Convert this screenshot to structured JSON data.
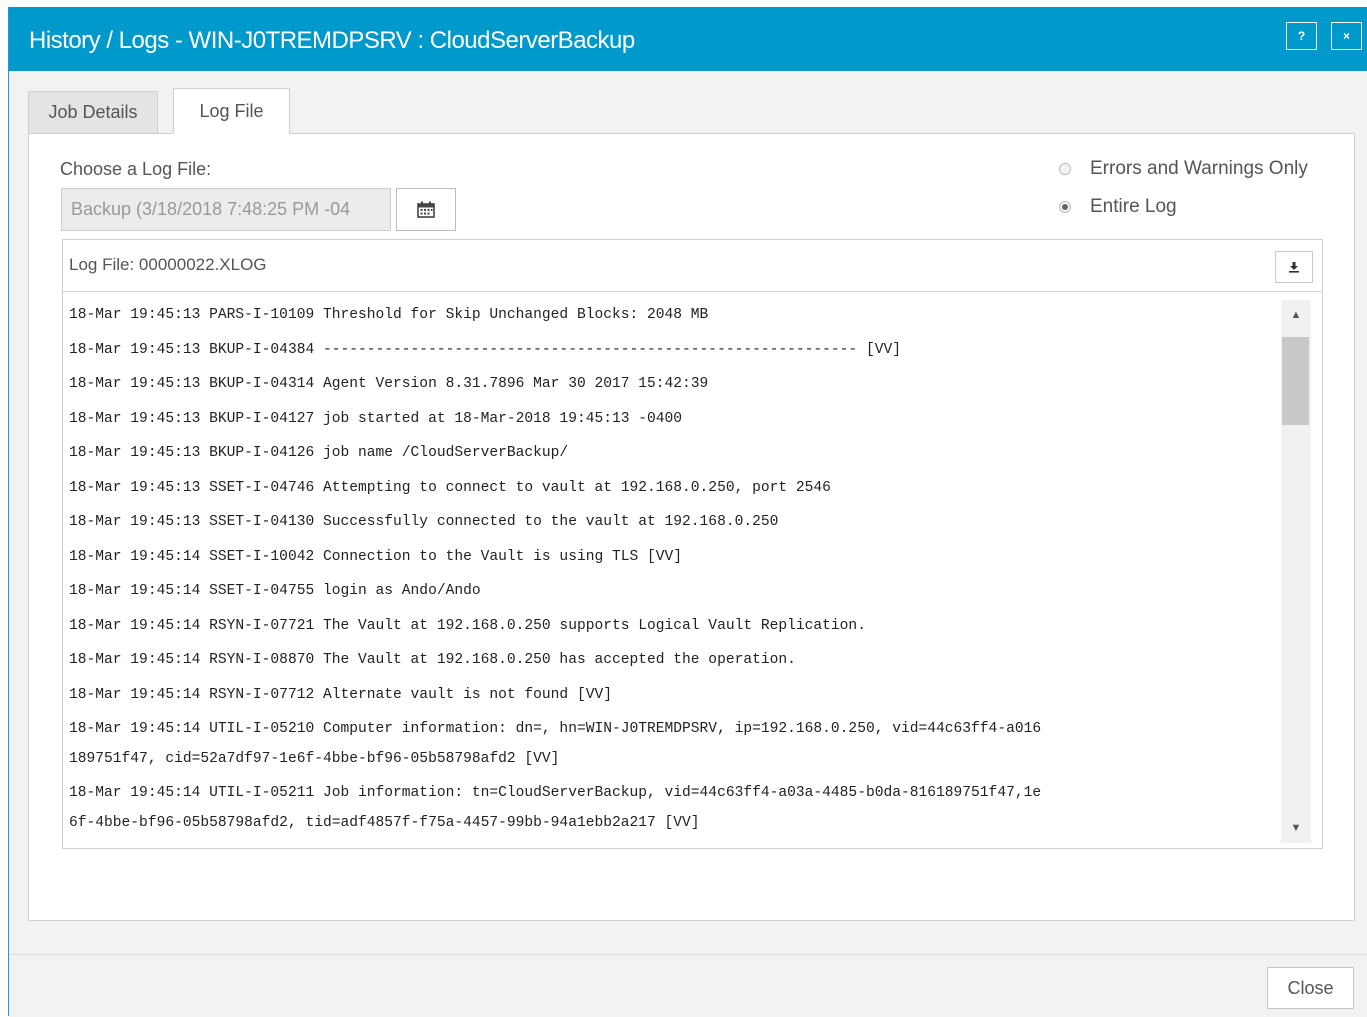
{
  "window": {
    "title": "History / Logs - WIN-J0TREMDPSRV : CloudServerBackup",
    "help_label": "?",
    "close_label": "×"
  },
  "tabs": [
    {
      "label": "Job Details",
      "active": false
    },
    {
      "label": "Log File",
      "active": true
    }
  ],
  "log_chooser": {
    "label": "Choose a Log File:",
    "selected": "Backup (3/18/2018 7:48:25 PM -04",
    "calendar_icon": "calendar-icon"
  },
  "filter": {
    "options": [
      {
        "label": "Errors and Warnings Only",
        "checked": false
      },
      {
        "label": "Entire Log",
        "checked": true
      }
    ]
  },
  "log": {
    "file_name": "Log File: 00000022.XLOG",
    "download_icon": "download-icon",
    "lines": [
      "18-Mar 19:45:13 PARS-I-10109 Threshold for Skip Unchanged Blocks: 2048 MB",
      "18-Mar 19:45:13 BKUP-I-04384 ------------------------------------------------------------- [VV]",
      "18-Mar 19:45:13 BKUP-I-04314 Agent Version 8.31.7896 Mar 30 2017 15:42:39",
      "18-Mar 19:45:13 BKUP-I-04127 job started at 18-Mar-2018 19:45:13 -0400",
      "18-Mar 19:45:13 BKUP-I-04126 job name /CloudServerBackup/",
      "18-Mar 19:45:13 SSET-I-04746 Attempting to connect to vault at 192.168.0.250, port 2546",
      "18-Mar 19:45:13 SSET-I-04130 Successfully connected to the vault at 192.168.0.250",
      "18-Mar 19:45:14 SSET-I-10042 Connection to the Vault is using TLS [VV]",
      "18-Mar 19:45:14 SSET-I-04755 login as Ando/Ando",
      "18-Mar 19:45:14 RSYN-I-07721 The Vault at 192.168.0.250 supports Logical Vault Replication.",
      "18-Mar 19:45:14 RSYN-I-08870 The Vault at 192.168.0.250 has accepted the operation.",
      "18-Mar 19:45:14 RSYN-I-07712 Alternate vault is not found [VV]"
    ],
    "wrapped_lines": [
      {
        "first": "18-Mar 19:45:14 UTIL-I-05210 Computer information: dn=, hn=WIN-J0TREMDPSRV, ip=192.168.0.250, vid=44c63ff4-a016",
        "second": "189751f47, cid=52a7df97-1e6f-4bbe-bf96-05b58798afd2 [VV]"
      },
      {
        "first": "18-Mar 19:45:14 UTIL-I-05211 Job information: tn=CloudServerBackup, vid=44c63ff4-a03a-4485-b0da-816189751f47,1e",
        "second": "6f-4bbe-bf96-05b58798afd2, tid=adf4857f-f75a-4457-99bb-94a1ebb2a217 [VV]"
      }
    ]
  },
  "footer": {
    "close_label": "Close"
  }
}
